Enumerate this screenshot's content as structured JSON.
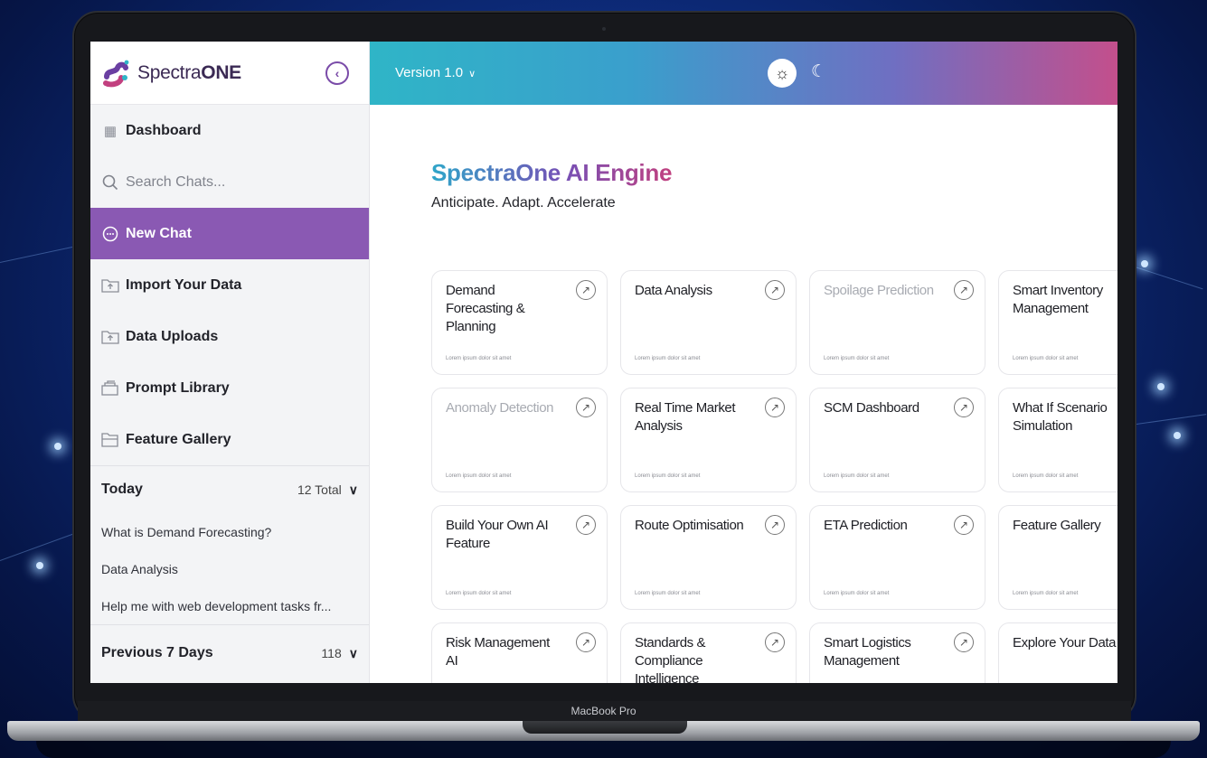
{
  "device_label": "MacBook Pro",
  "brand": {
    "name_light": "Spectra",
    "name_bold": "ONE"
  },
  "sidebar": {
    "nav": [
      {
        "label": "Dashboard",
        "icon": "dashboard-icon"
      },
      {
        "label": "",
        "placeholder": "Search Chats...",
        "icon": "search-icon"
      },
      {
        "label": "New Chat",
        "icon": "chat-bubble-icon"
      },
      {
        "label": "Import Your Data",
        "icon": "folder-upload-icon"
      },
      {
        "label": "Data Uploads",
        "icon": "folder-upload-icon"
      },
      {
        "label": "Prompt Library",
        "icon": "library-icon"
      },
      {
        "label": "Feature Gallery",
        "icon": "gallery-folder-icon"
      }
    ],
    "search_placeholder": "Search Chats...",
    "today": {
      "title": "Today",
      "count": "12 Total",
      "chats": [
        "What is Demand Forecasting?",
        "Data Analysis",
        "Help me with web development tasks fr..."
      ]
    },
    "previous": {
      "title": "Previous 7 Days",
      "count": "118"
    }
  },
  "header": {
    "version": "Version 1.0"
  },
  "hero": {
    "title": "SpectraOne AI Engine",
    "subtitle": "Anticipate. Adapt. Accelerate"
  },
  "cards": [
    {
      "title": "Demand Forecasting & Planning",
      "desc": "Lorem ipsum dolor sit amet",
      "muted": false
    },
    {
      "title": "Data Analysis",
      "desc": "Lorem ipsum dolor sit amet",
      "muted": false
    },
    {
      "title": "Spoilage Prediction",
      "desc": "Lorem ipsum dolor sit amet",
      "muted": true
    },
    {
      "title": "Smart Inventory Management",
      "desc": "Lorem ipsum dolor sit amet",
      "muted": false
    },
    {
      "title": "Anomaly Detection",
      "desc": "Lorem ipsum dolor sit amet",
      "muted": true
    },
    {
      "title": "Real Time Market Analysis",
      "desc": "Lorem ipsum dolor sit amet",
      "muted": false
    },
    {
      "title": "SCM Dashboard",
      "desc": "Lorem ipsum dolor sit amet",
      "muted": false
    },
    {
      "title": "What If Scenario Simulation",
      "desc": "Lorem ipsum dolor sit amet",
      "muted": false
    },
    {
      "title": "Build Your Own AI Feature",
      "desc": "Lorem ipsum dolor sit amet",
      "muted": false
    },
    {
      "title": "Route Optimisation",
      "desc": "Lorem ipsum dolor sit amet",
      "muted": false
    },
    {
      "title": "ETA Prediction",
      "desc": "Lorem ipsum dolor sit amet",
      "muted": false
    },
    {
      "title": "Feature Gallery",
      "desc": "Lorem ipsum dolor sit amet",
      "muted": false
    },
    {
      "title": "Risk Management AI",
      "desc": "",
      "muted": false
    },
    {
      "title": "Standards & Compliance Intelligence",
      "desc": "",
      "muted": false
    },
    {
      "title": "Smart Logistics Management",
      "desc": "",
      "muted": false
    },
    {
      "title": "Explore Your Data",
      "desc": "",
      "muted": false
    }
  ],
  "colors": {
    "active_nav": "#8a59b3",
    "header_gradient_start": "#2fb5c7",
    "header_gradient_end": "#c34f8c"
  }
}
